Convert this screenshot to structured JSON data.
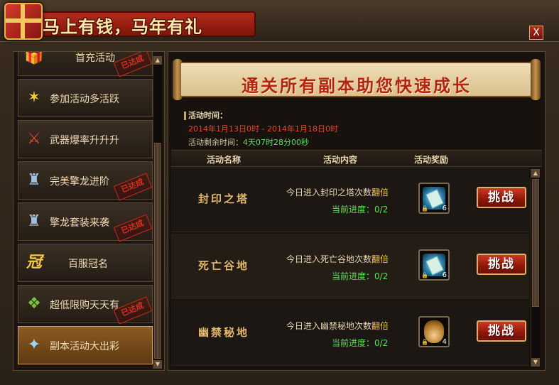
{
  "window": {
    "title": "马上有钱，马年有礼",
    "close_label": "X"
  },
  "sidebar": {
    "items": [
      {
        "label": "首充活动",
        "icon": "gift-box-icon",
        "stamp": "已达成"
      },
      {
        "label": "参加活动多活跃",
        "icon": "fireworks-icon",
        "stamp": ""
      },
      {
        "label": "武器爆率升升升",
        "icon": "weapon-icon",
        "stamp": ""
      },
      {
        "label": "完美擎龙进阶",
        "icon": "armor-icon",
        "stamp": "已达成"
      },
      {
        "label": "擎龙套装来袭",
        "icon": "armor-set-icon",
        "stamp": "已达成"
      },
      {
        "label": "百服冠名",
        "icon": "crown-glyph-icon",
        "stamp": ""
      },
      {
        "label": "超低限购天天有",
        "icon": "present-icon",
        "stamp": "已达成"
      },
      {
        "label": "副本活动大出彩",
        "icon": "dungeon-icon",
        "stamp": ""
      }
    ],
    "active_index": 7,
    "crown_glyph": "冠"
  },
  "main": {
    "banner": "通关所有副本助您快速成长",
    "activity_time_label": "活动时间：",
    "activity_range": "2014年1月13日0时 - 2014年1月18日0时",
    "remaining_label": "活动剩余时间：",
    "remaining_value": "4天07时28分00秒",
    "columns": {
      "name": "活动名称",
      "content": "活动内容",
      "reward": "活动奖励"
    },
    "rows": [
      {
        "name": "封印之塔",
        "desc_prefix": "今日进入封印之塔次数",
        "desc_highlight": "翻倍",
        "progress": "当前进度：0/2",
        "reward_icon": "scroll-icon",
        "reward_qty": "6",
        "button": "挑战"
      },
      {
        "name": "死亡谷地",
        "desc_prefix": "今日进入死亡谷地次数",
        "desc_highlight": "翻倍",
        "progress": "当前进度：0/2",
        "reward_icon": "scroll-icon",
        "reward_qty": "6",
        "button": "挑战"
      },
      {
        "name": "幽禁秘地",
        "desc_prefix": "今日进入幽禁秘地次数",
        "desc_highlight": "翻倍",
        "progress": "当前进度：0/2",
        "reward_icon": "bottle-icon",
        "reward_qty": "4",
        "button": "挑战"
      }
    ]
  },
  "colors": {
    "accent_red": "#b42412",
    "progress_green": "#5ee05a",
    "highlight_gold": "#f2c74a"
  }
}
